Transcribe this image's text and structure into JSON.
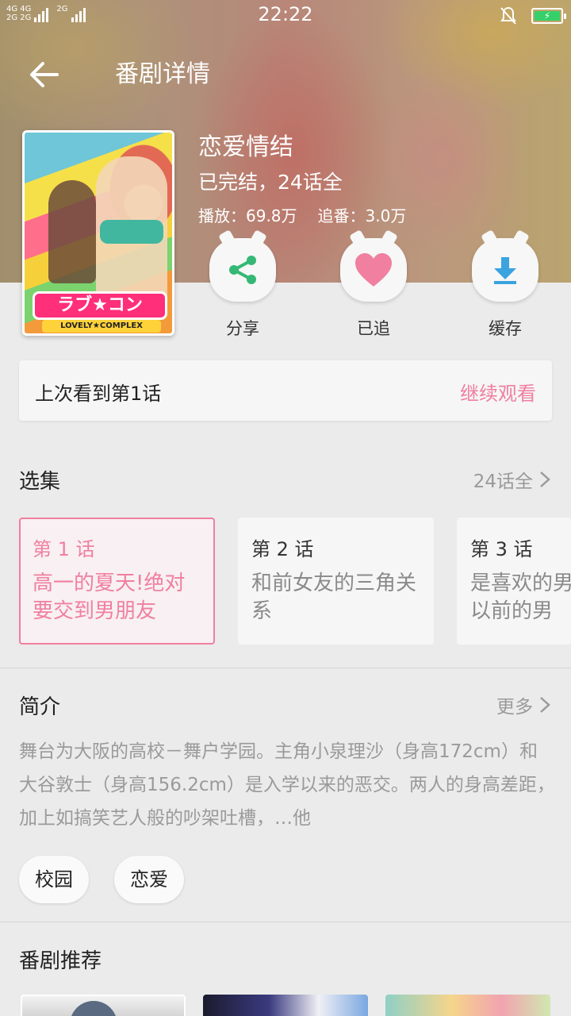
{
  "status_bar": {
    "time": "22:22",
    "network_left": "4G 4G",
    "network_left2": "2G 2G",
    "network_right": "2G"
  },
  "nav": {
    "title": "番剧详情"
  },
  "show": {
    "title": "恋爱情结",
    "status": "已完结，24话全",
    "plays": "播放：69.8万",
    "follows": "追番：3.0万",
    "poster_logo": "ラブ★コン",
    "poster_logo_sub": "LOVELY★COMPLEX"
  },
  "actions": [
    {
      "label": "分享",
      "icon": "share-icon"
    },
    {
      "label": "已追",
      "icon": "heart-icon"
    },
    {
      "label": "缓存",
      "icon": "download-icon"
    }
  ],
  "continue": {
    "text": "上次看到第1话",
    "button": "继续观看"
  },
  "episodes_section": {
    "title": "选集",
    "more": "24话全"
  },
  "episodes": [
    {
      "num": "第 1 话",
      "title": "高一的夏天!绝对要交到男朋友"
    },
    {
      "num": "第 2 话",
      "title": "和前女友的三角关系"
    },
    {
      "num": "第 3 话",
      "title": "是喜欢的男人还是以前的男"
    }
  ],
  "intro_section": {
    "title": "简介",
    "more": "更多",
    "text": "舞台为大阪的高校－舞户学园。主角小泉理沙（身高172cm）和大谷敦士（身高156.2cm）是入学以来的恶交。两人的身高差距，加上如搞笑艺人般的吵架吐槽，…他"
  },
  "tags": [
    "校园",
    "恋爱"
  ],
  "recommend_section": {
    "title": "番剧推荐"
  },
  "colors": {
    "accent": "#f07fa0",
    "share_green": "#35b875",
    "heart_pink": "#f07fa0",
    "download_blue": "#3aa3e0"
  }
}
